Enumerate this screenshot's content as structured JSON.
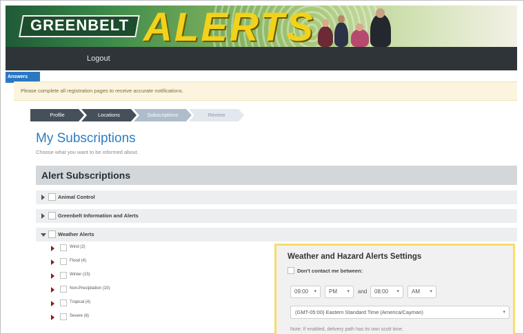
{
  "banner": {
    "logo_text": "GREENBELT",
    "alerts_text": "ALERTS"
  },
  "nav": {
    "logout_label": "Logout"
  },
  "answers_tab": "Answers",
  "notice": "Please complete all registration pages to receive accurate notifications.",
  "steps": [
    {
      "label": "Profile",
      "state": "complete"
    },
    {
      "label": "Locations",
      "state": "complete"
    },
    {
      "label": "Subscriptions",
      "state": "current"
    },
    {
      "label": "Review",
      "state": "upcoming"
    }
  ],
  "page": {
    "title": "My Subscriptions",
    "subtitle": "Choose what you want to be informed about."
  },
  "section": {
    "title": "Alert Subscriptions"
  },
  "categories": [
    {
      "label": "Animal Control",
      "expanded": false
    },
    {
      "label": "Greenbelt Information and Alerts",
      "expanded": false
    },
    {
      "label": "Weather Alerts",
      "expanded": true
    }
  ],
  "weather_items": [
    {
      "label": "Wind (2)"
    },
    {
      "label": "Flood (4)"
    },
    {
      "label": "Winter (15)"
    },
    {
      "label": "Non-Precipitation (10)"
    },
    {
      "label": "Tropical (4)"
    },
    {
      "label": "Severe (8)"
    }
  ],
  "settings": {
    "title": "Weather and Hazard Alerts Settings",
    "dont_contact_label": "Don't contact me between:",
    "start_time": "09:00",
    "start_ampm": "PM",
    "and_label": "and",
    "end_time": "08:00",
    "end_ampm": "AM",
    "timezone": "(GMT-05:00) Eastern Standard Time (America/Cayman)",
    "note": "Note: If enabled, delivery path has its own scott time.",
    "caret": "▾"
  },
  "colors": {
    "title_blue": "#2b7cc4",
    "nav_dark": "#2f3438",
    "highlight": "#f7dd6a"
  }
}
